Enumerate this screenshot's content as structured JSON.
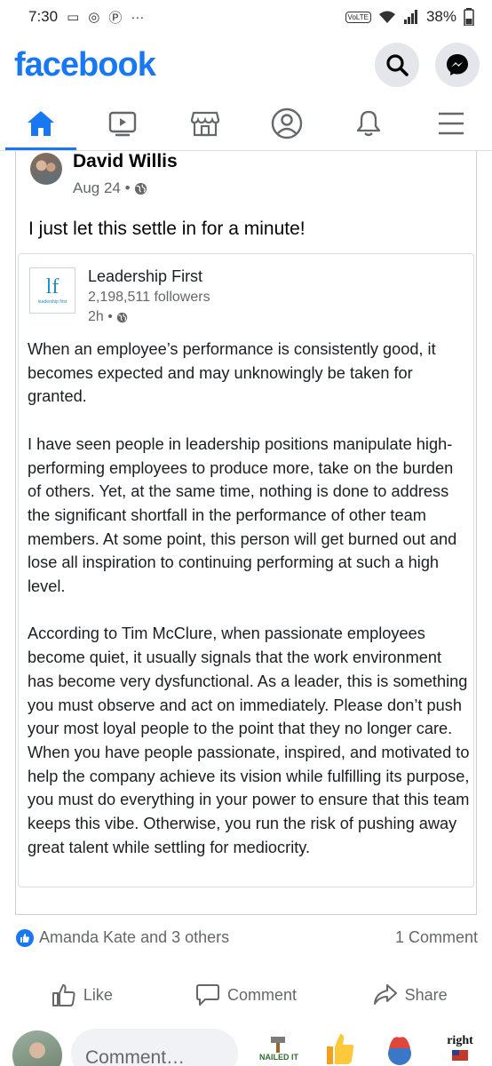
{
  "status_bar": {
    "time": "7:30",
    "network_label": "VoLTE",
    "battery": "38%",
    "more": "···"
  },
  "header": {
    "logo": "facebook"
  },
  "post": {
    "author_name": "David Willis",
    "date": "Aug 24 •",
    "text": "I just let this settle in for a minute!",
    "shared": {
      "page_name": "Leadership First",
      "logo_text": "lf",
      "logo_sub": "leadership first",
      "followers": "2,198,511 followers",
      "time": "2h •",
      "paragraphs": [
        "When an employee’s performance is consistently good, it becomes expected and may unknowingly be taken for granted.",
        "I have seen people in leadership positions manipulate high-performing employees to produce more, take on the burden of others. Yet, at the same time, nothing is done to address the significant shortfall in the performance of other team members.  At some point, this person will get burned out and lose all inspiration to continuing performing at such a high level.",
        "According to Tim McClure, when passionate employees become quiet, it usually signals that the work environment has become very dysfunctional. As a leader, this is something you must observe and act on immediately. Please don’t push your most loyal people to the point that they no longer care. When you have people passionate, inspired, and motivated to help the company achieve its vision while fulfilling its purpose, you must do everything in your power to ensure that this team keeps this vibe. Otherwise, you run the risk of pushing away great talent while settling for mediocrity."
      ]
    },
    "reactions_text": "Amanda Kate and 3 others",
    "comments_text": "1 Comment",
    "actions": {
      "like": "Like",
      "comment": "Comment",
      "share": "Share"
    }
  },
  "comment_bar": {
    "placeholder": "Comment…",
    "stickers": [
      "NAILED IT",
      "right"
    ]
  },
  "colors": {
    "brand": "#1877f2",
    "secondary_text": "#65676b"
  }
}
